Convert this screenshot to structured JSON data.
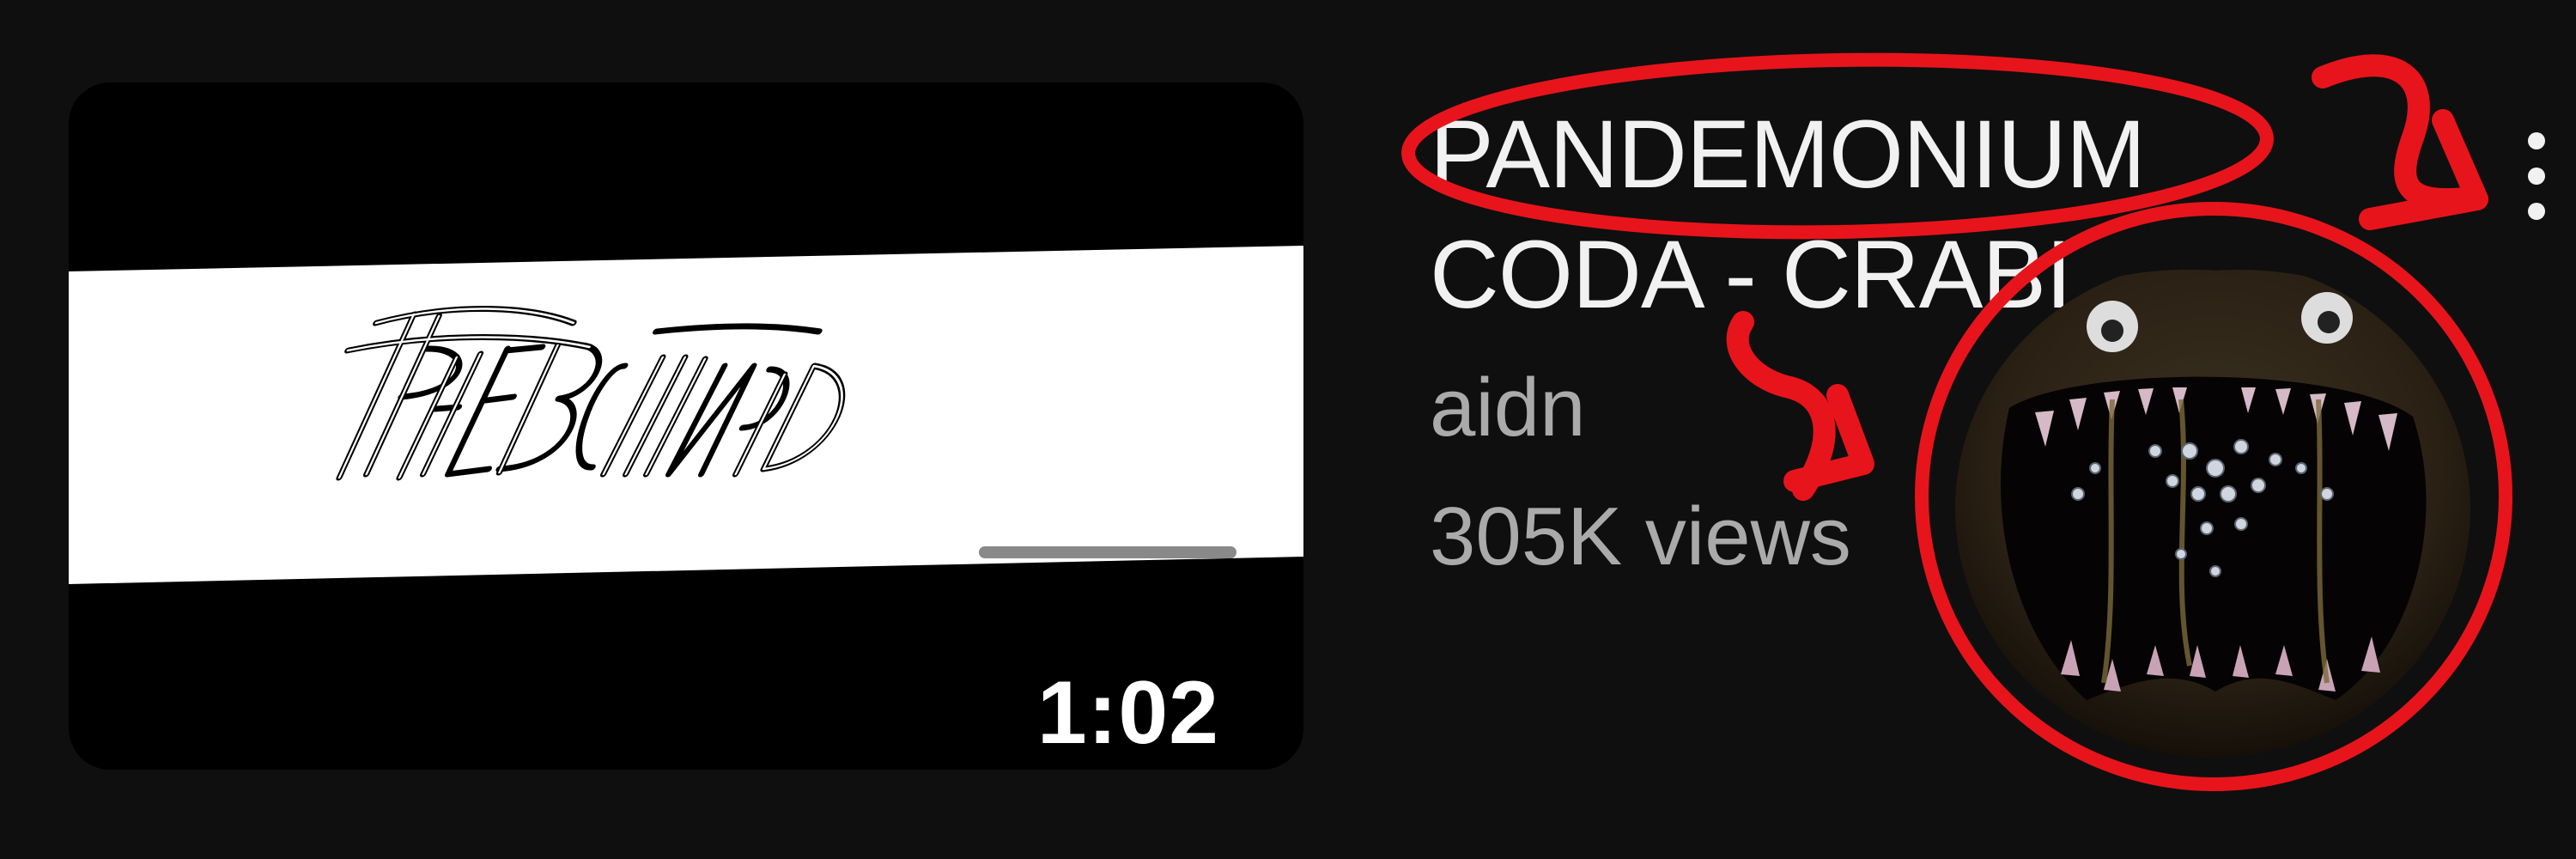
{
  "video": {
    "title_line1": "PANDEMONIUM",
    "title_line2": "CODA - CRABI",
    "channel": "aidn",
    "views": "305K views",
    "duration": "1:02",
    "thumbnail_logo": "PANDEMONIUM logo",
    "thumbnail_logo_text": "PANDEMONIUM"
  },
  "icons": {
    "more": "more-vert-icon"
  },
  "annotations": {
    "color": "#e8141b",
    "circles": [
      "title-highlight-circle",
      "monster-circle"
    ],
    "arrows": [
      "curved-arrow-top",
      "curved-arrow-left"
    ]
  },
  "colors": {
    "background": "#0f0f0f",
    "title": "#f1f1f1",
    "meta": "#aaaaaa",
    "annotation": "#e8141b"
  }
}
